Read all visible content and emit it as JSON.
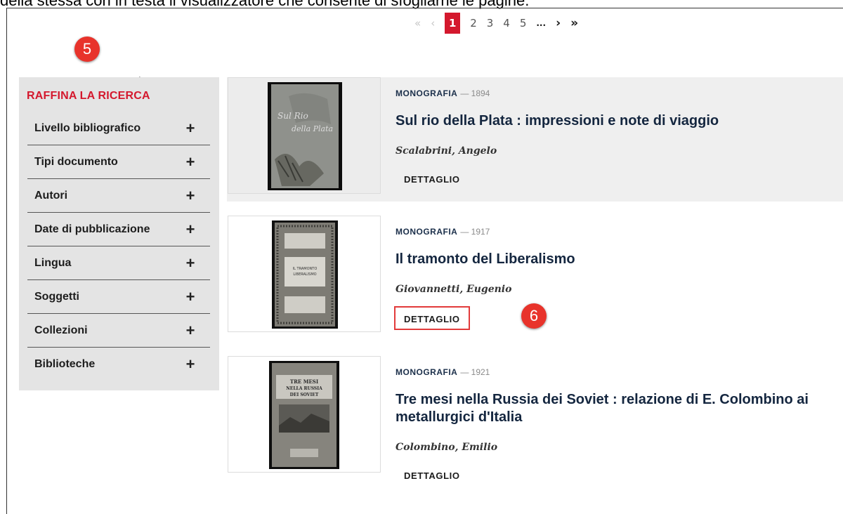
{
  "caption": "della stessa con in testa il visualizzatore che consente di sfogliarne le pagine.",
  "pagination": {
    "first": "«",
    "prev": "‹",
    "pages": [
      "1",
      "2",
      "3",
      "4",
      "5"
    ],
    "current": "1",
    "ellipsis": "...",
    "next": "›",
    "last": "»"
  },
  "annotations": {
    "badge5": "5",
    "badge6": "6"
  },
  "sidebar": {
    "title": "RAFFINA LA RICERCA",
    "expand_symbol": "+",
    "filters": [
      "Livello bibliografico",
      "Tipi documento",
      "Autori",
      "Date di pubblicazione",
      "Lingua",
      "Soggetti",
      "Collezioni",
      "Biblioteche"
    ]
  },
  "results": [
    {
      "type": "MONOGRAFIA",
      "year": "— 1894",
      "title": "Sul rio della Plata : impressioni e note di viaggio",
      "author": "Scalabrini, Angelo",
      "button": "DETTAGLIO",
      "cover_text": "Sul Rio della Plata"
    },
    {
      "type": "MONOGRAFIA",
      "year": "— 1917",
      "title": "Il tramonto del Liberalismo",
      "author": "Giovannetti, Eugenio",
      "button": "DETTAGLIO",
      "cover_text": "IL TRAMONTO DEL LIBERALISMO"
    },
    {
      "type": "MONOGRAFIA",
      "year": "— 1921",
      "title": "Tre mesi nella Russia dei Soviet : relazione di E. Colombino ai metallurgici d'Italia",
      "author": "Colombino, Emilio",
      "button": "DETTAGLIO",
      "cover_text": "TRE MESI NELLA RUSSIA DEI SOVIET"
    }
  ],
  "colors": {
    "accent": "#d4182d",
    "sidebar_bg": "#e4e4e4",
    "title": "#14263f",
    "badge": "#e8332b"
  }
}
